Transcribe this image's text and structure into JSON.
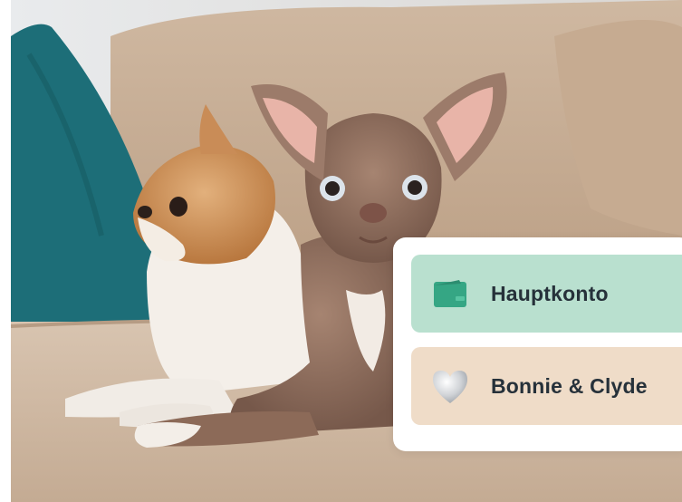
{
  "photo": {
    "subject": "dogs-on-sofa-photo"
  },
  "accounts": [
    {
      "label": "Hauptkonto",
      "icon": "wallet-icon",
      "color": "#b9e0cf"
    },
    {
      "label": "Bonnie & Clyde",
      "icon": "heart-icon",
      "color": "#efdcc8"
    }
  ]
}
